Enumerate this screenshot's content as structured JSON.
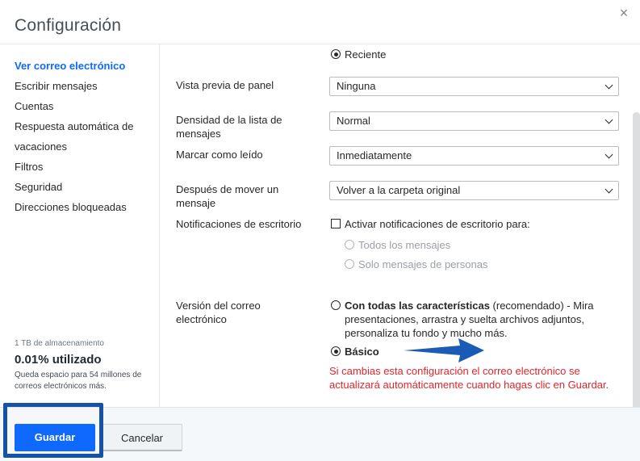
{
  "dialog": {
    "title": "Configuración",
    "close_label": "×"
  },
  "sidebar": {
    "items": [
      {
        "label": "Ver correo electrónico",
        "active": true
      },
      {
        "label": "Escribir mensajes"
      },
      {
        "label": "Cuentas"
      },
      {
        "label": "Respuesta automática de"
      },
      {
        "label": "vacaciones"
      },
      {
        "label": "Filtros"
      },
      {
        "label": "Seguridad"
      },
      {
        "label": "Direcciones bloqueadas"
      }
    ],
    "storage": {
      "capacity": "1 TB de almacenamiento",
      "used": "0.01% utilizado",
      "remaining": "Queda espacio para 54 millones de correos electrónicos más."
    }
  },
  "settings": {
    "recent_option": "Reciente",
    "preview_label": "Vista previa de panel",
    "preview_value": "Ninguna",
    "density_label": "Densidad de la lista de mensajes",
    "density_value": "Normal",
    "mark_read_label": "Marcar como leído",
    "mark_read_value": "Inmediatamente",
    "after_move_label": "Después de mover un mensaje",
    "after_move_value": "Volver a la carpeta original",
    "notifications_label": "Notificaciones de escritorio",
    "notifications_checkbox": "Activar notificaciones de escritorio para:",
    "notif_all": "Todos los mensajes",
    "notif_people": "Solo mensajes de personas",
    "version_label": "Versión del correo electrónico",
    "version_full_bold": "Con todas las características",
    "version_full_rest": " (recomendado) - Mira presentaciones, arrastra y suelta archivos adjuntos, personaliza tu fondo y mucho más.",
    "version_basic": "Básico",
    "warning": "Si cambias esta configuración el correo electrónico se actualizará automáticamente cuando hagas clic en Guardar."
  },
  "footer": {
    "save_label": "Guardar",
    "cancel_label": "Cancelar"
  },
  "colors": {
    "accent": "#0f69ff",
    "warning": "#e1252b",
    "highlight_box": "#1652a8",
    "arrow": "#1a5bb5"
  }
}
